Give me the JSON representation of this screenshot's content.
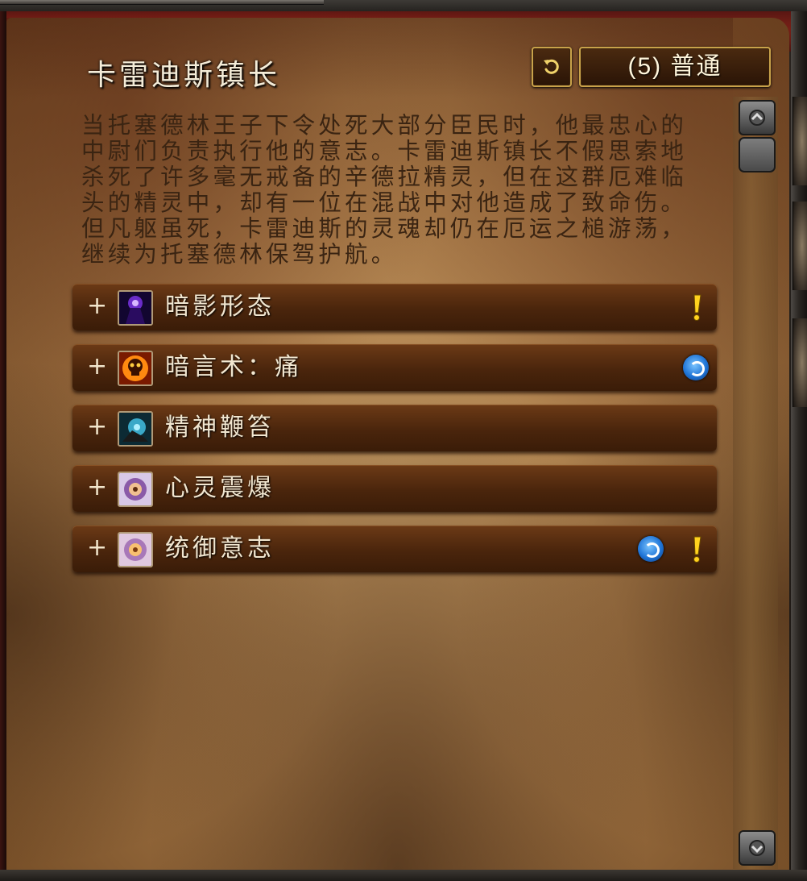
{
  "window": {
    "title": "卡雷迪斯镇长",
    "reset_icon": "reset-icon",
    "difficulty": "(5) 普通"
  },
  "description": "当托塞德林王子下令处死大部分臣民时，他最忠心的\n中尉们负责执行他的意志。卡雷迪斯镇长不假思索地\n杀死了许多毫无戒备的辛德拉精灵，但在这群厄难临\n头的精灵中，却有一位在混战中对他造成了致命伤。\n但凡躯虽死，卡雷迪斯的灵魂却仍在厄运之槌游荡，\n继续为托塞德林保驾护航。",
  "abilities": [
    {
      "expand": "+",
      "label": "暗影形态",
      "icon": "shadowform-icon",
      "flags": [
        "alert"
      ]
    },
    {
      "expand": "+",
      "label": "暗言术：痛",
      "icon": "shadow-word-pain-icon",
      "flags": [
        "magic"
      ]
    },
    {
      "expand": "+",
      "label": "精神鞭笞",
      "icon": "mind-flay-icon",
      "flags": []
    },
    {
      "expand": "+",
      "label": "心灵震爆",
      "icon": "mind-blast-icon",
      "flags": []
    },
    {
      "expand": "+",
      "label": "统御意志",
      "icon": "dominate-mind-icon",
      "flags": [
        "magic",
        "alert"
      ]
    }
  ],
  "colors": {
    "accent_gold": "#c8a24a",
    "alert_yellow": "#ffd21e",
    "magic_blue": "#1f74d6"
  }
}
